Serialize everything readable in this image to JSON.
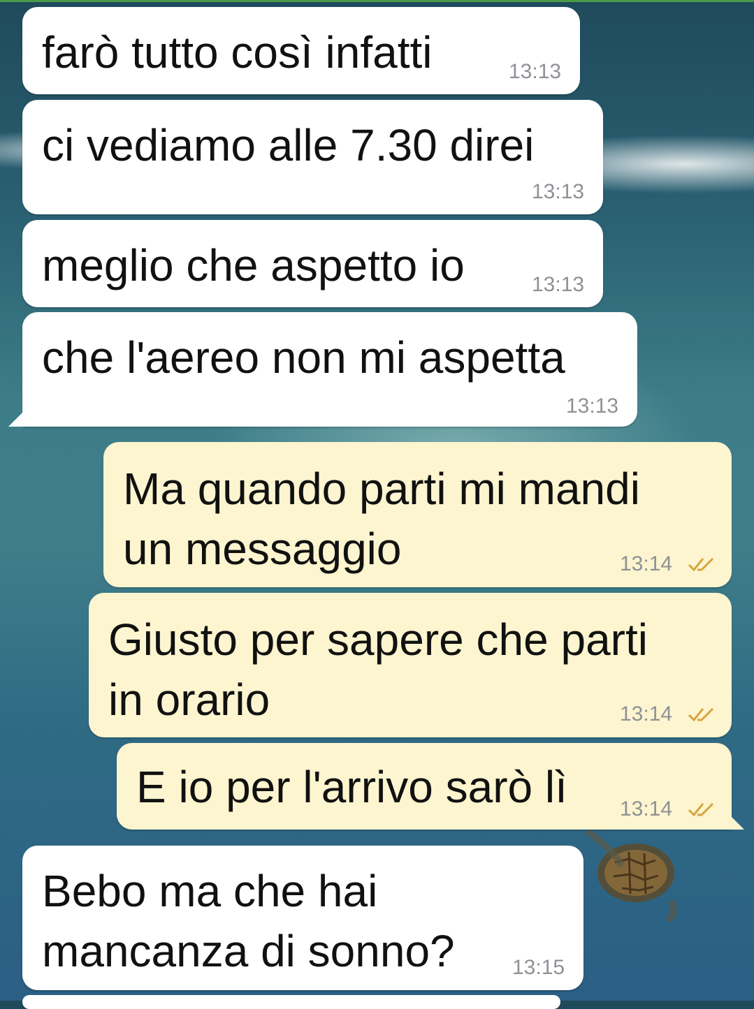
{
  "messages": [
    {
      "text": "farò tutto così infatti",
      "time": "13:13",
      "direction": "incoming"
    },
    {
      "text": "ci vediamo alle 7.30 direi",
      "time": "13:13",
      "direction": "incoming"
    },
    {
      "text": "meglio che aspetto io",
      "time": "13:13",
      "direction": "incoming"
    },
    {
      "text": "che l'aereo non mi aspetta",
      "time": "13:13",
      "direction": "incoming"
    },
    {
      "text": "Ma quando parti mi mandi\nun messaggio",
      "time": "13:14",
      "direction": "outgoing",
      "status": "read-ticks-icon"
    },
    {
      "text": "Giusto per sapere che parti\nin orario",
      "time": "13:14",
      "direction": "outgoing",
      "status": "read-ticks-icon"
    },
    {
      "text": "E io per l'arrivo sarò lì",
      "time": "13:14",
      "direction": "outgoing",
      "status": "read-ticks-icon"
    },
    {
      "text": "Bebo ma che hai\nmancanza di sonno?",
      "time": "13:15",
      "direction": "incoming"
    }
  ],
  "colors": {
    "incoming_bubble": "#ffffff",
    "outgoing_bubble": "#fcf5cf",
    "timestamp": "#8e9196",
    "read_ticks": "#d9a441"
  }
}
